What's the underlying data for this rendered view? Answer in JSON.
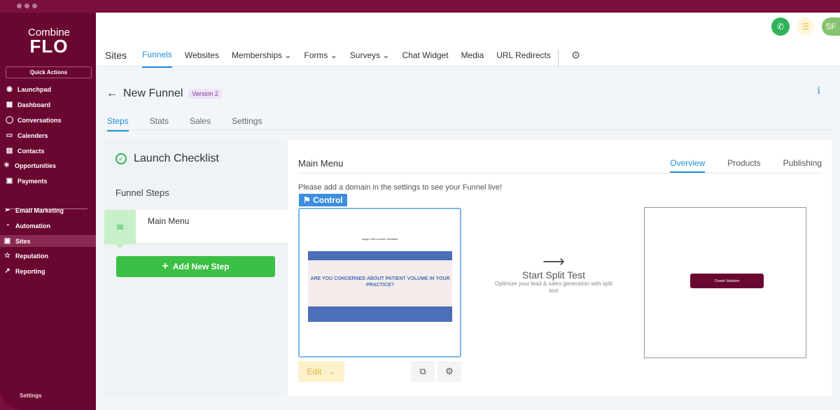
{
  "brand": {
    "line1": "Combine",
    "line2": "FLO"
  },
  "sidebar": {
    "quick_actions": "Quick Actions",
    "items": [
      {
        "label": "Launchpad",
        "icon": "lightbulb-icon"
      },
      {
        "label": "Dashboard",
        "icon": "grid-icon"
      },
      {
        "label": "Conversations",
        "icon": "chat-icon"
      },
      {
        "label": "Calenders",
        "icon": "calendar-icon"
      },
      {
        "label": "Contacts",
        "icon": "contacts-icon"
      },
      {
        "label": "Opportunities",
        "icon": "sparkle-icon"
      },
      {
        "label": "Payments",
        "icon": "receipt-icon"
      },
      {
        "label": "Email Marketing",
        "icon": "send-icon"
      },
      {
        "label": "Automation",
        "icon": "automation-icon"
      },
      {
        "label": "Sites",
        "icon": "browser-icon",
        "active": true
      },
      {
        "label": "Reputation",
        "icon": "star-icon"
      },
      {
        "label": "Reporting",
        "icon": "trend-icon"
      }
    ],
    "settings": "Settings"
  },
  "header": {
    "avatar": "SF",
    "title": "Sites",
    "nav": [
      {
        "label": "Funnels",
        "active": true
      },
      {
        "label": "Websites"
      },
      {
        "label": "Memberships ⌄"
      },
      {
        "label": "Forms ⌄"
      },
      {
        "label": "Surveys ⌄"
      },
      {
        "label": "Chat Widget"
      },
      {
        "label": "Media"
      },
      {
        "label": "URL Redirects"
      }
    ]
  },
  "funnel": {
    "back": "←",
    "title": "New Funnel",
    "version": "Version 2",
    "info": "i",
    "tabs": [
      "Steps",
      "Stats",
      "Sales",
      "Settings"
    ]
  },
  "left": {
    "checklist": "Launch Checklist",
    "funnel_steps": "Funnel Steps",
    "step": "Main Menu",
    "add_step": "Add New Step"
  },
  "right": {
    "title": "Main Menu",
    "tabs": [
      "Overview",
      "Products",
      "Publishing"
    ],
    "warning": "Please add a domain in the settings to see your Funnel live!",
    "control": "Control",
    "thumb_headline": "Large Call to Action Headline",
    "thumb_hero": "ARE YOU CONCERNED ABOUT PATIENT VOLUME IN YOUR PRACTICE?",
    "edit": "Edit",
    "split_title": "Start Split Test",
    "split_sub": "Optimize your lead & sales generation with split test",
    "create_variation": "Create Variation"
  },
  "colors": {
    "brand": "#6a0731",
    "accent": "#1e8fd6",
    "success": "#3bbf45"
  }
}
